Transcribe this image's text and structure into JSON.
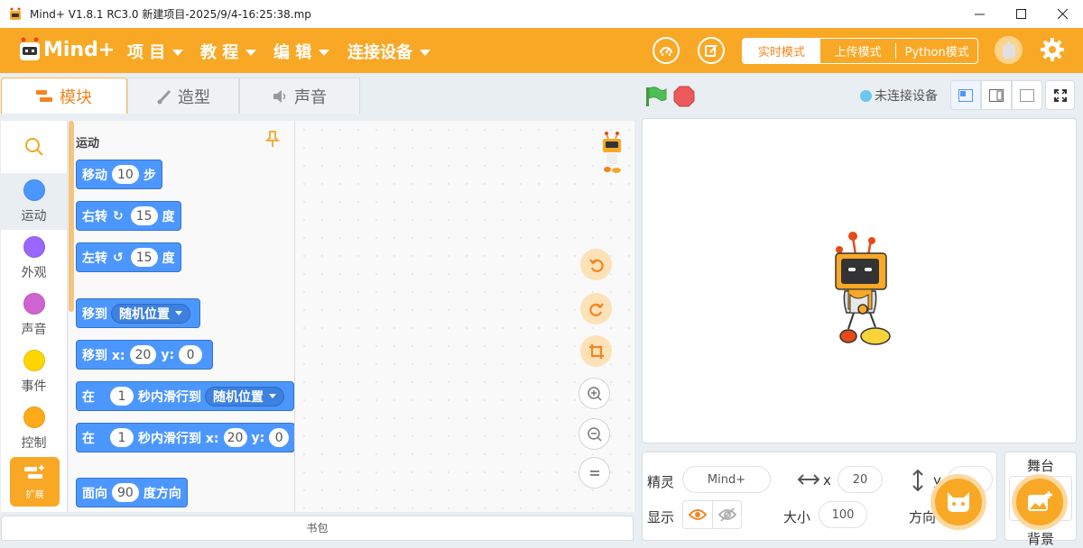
{
  "window": {
    "title": "Mind+ V1.8.1 RC3.0   新建项目-2025/9/4-16:25:38.mp"
  },
  "menubar": {
    "logo_text": "Mind+",
    "menus": [
      {
        "label": "项 目"
      },
      {
        "label": "教 程"
      },
      {
        "label": "编 辑"
      },
      {
        "label": "连接设备"
      }
    ],
    "modes": [
      {
        "label": "实时模式"
      },
      {
        "label": "上传模式"
      },
      {
        "label": "Python模式"
      }
    ],
    "accent_color": "#f9a825"
  },
  "tabs": [
    {
      "label": "模块"
    },
    {
      "label": "造型"
    },
    {
      "label": "声音"
    }
  ],
  "toolbar": {
    "device_status": "未连接设备"
  },
  "categories": [
    {
      "label": "运动",
      "color": "#4c97ff"
    },
    {
      "label": "外观",
      "color": "#9966ff"
    },
    {
      "label": "声音",
      "color": "#cf63cf"
    },
    {
      "label": "事件",
      "color": "#ffd500"
    },
    {
      "label": "控制",
      "color": "#ffab19"
    }
  ],
  "extension": {
    "label": "扩展"
  },
  "palette": {
    "title": "运动",
    "blocks": {
      "move": {
        "text": "移动",
        "value": "10",
        "suffix": "步"
      },
      "turn_right": {
        "text": "右转",
        "value": "15",
        "suffix": "度"
      },
      "turn_left": {
        "text": "左转",
        "value": "15",
        "suffix": "度"
      },
      "goto": {
        "text": "移到",
        "menu": "随机位置"
      },
      "goto_xy": {
        "text": "移到 x:",
        "x": "20",
        "y_label": "y:",
        "y": "0"
      },
      "glide": {
        "prefix": "在",
        "value": "1",
        "text": "秒内滑行到",
        "menu": "随机位置"
      },
      "glide_xy": {
        "prefix": "在",
        "value": "1",
        "text": "秒内滑行到 x:",
        "x": "20",
        "y_label": "y:",
        "y": "0"
      },
      "point": {
        "prefix": "面向",
        "value": "90",
        "suffix": "度方向"
      }
    }
  },
  "backpack": {
    "label": "书包"
  },
  "sprite_info": {
    "sprite_label": "精灵",
    "sprite_name": "Mind+",
    "x_label": "x",
    "x_value": "20",
    "y_label": "y",
    "show_label": "显示",
    "size_label": "大小",
    "size_value": "100",
    "direction_label": "方向"
  },
  "stage_panel": {
    "label": "舞台",
    "backdrop_label": "背景"
  }
}
